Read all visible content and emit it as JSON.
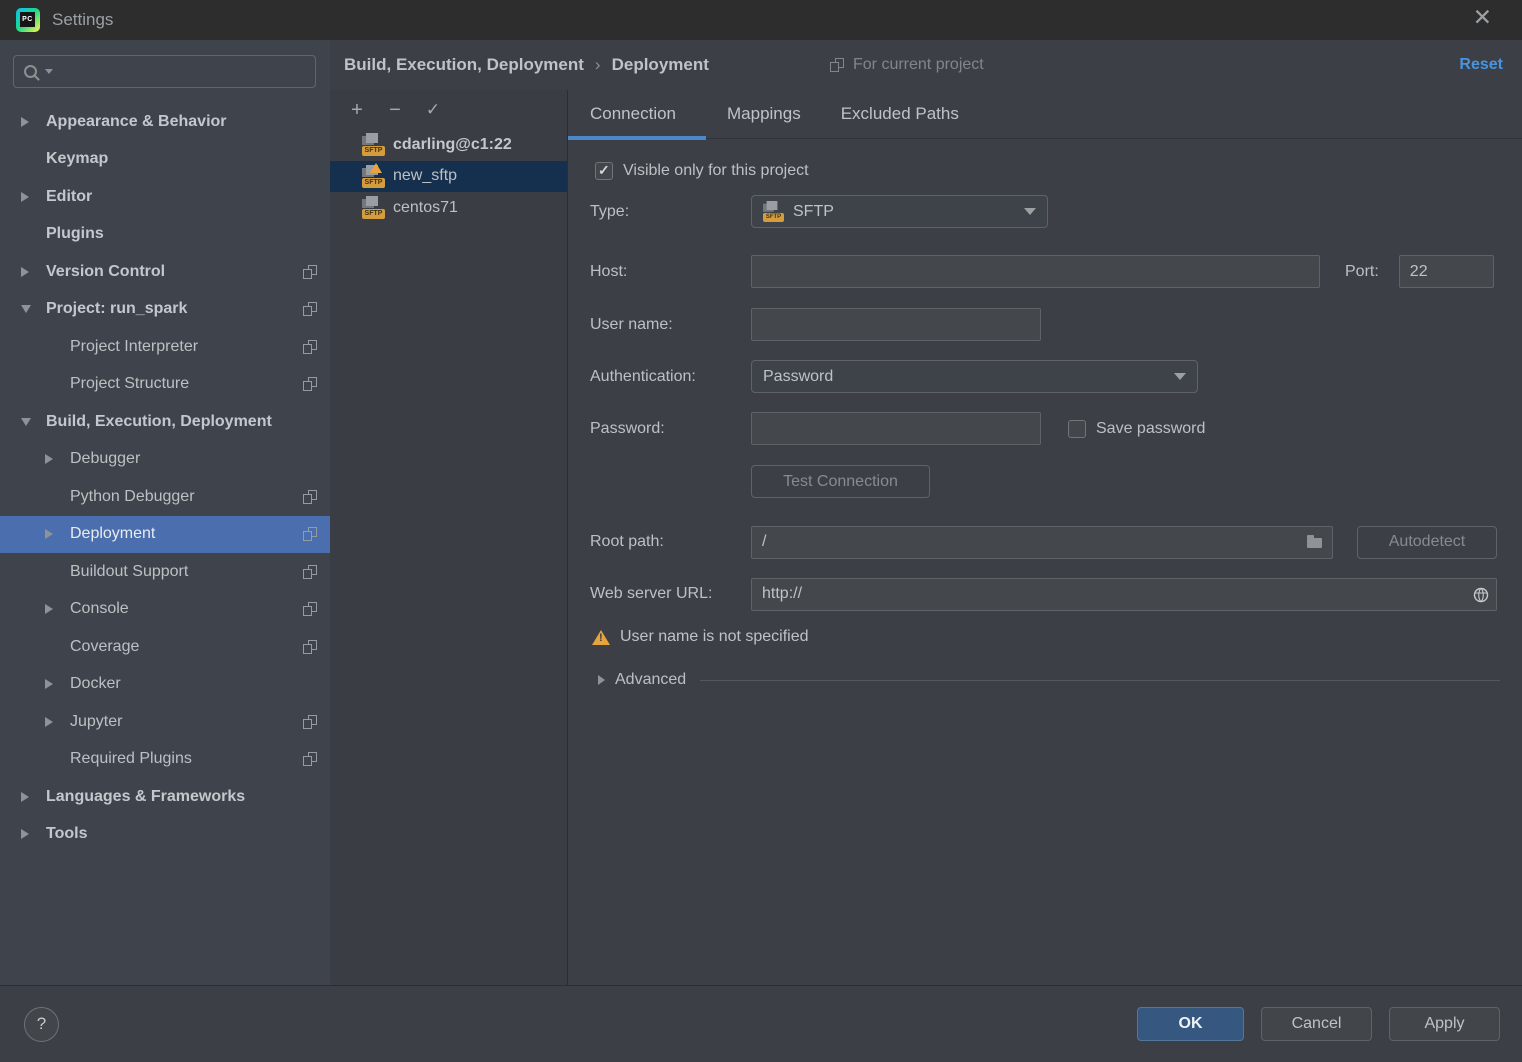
{
  "window": {
    "title": "Settings",
    "close_glyph": "✕",
    "logo_text": "PC"
  },
  "sidebar": {
    "search": {
      "value": "",
      "placeholder": ""
    },
    "items": [
      {
        "label": "Appearance & Behavior"
      },
      {
        "label": "Keymap"
      },
      {
        "label": "Editor"
      },
      {
        "label": "Plugins"
      },
      {
        "label": "Version Control"
      },
      {
        "label": "Project: run_spark"
      },
      {
        "label": "Project Interpreter"
      },
      {
        "label": "Project Structure"
      },
      {
        "label": "Build, Execution, Deployment"
      },
      {
        "label": "Debugger"
      },
      {
        "label": "Python Debugger"
      },
      {
        "label": "Deployment"
      },
      {
        "label": "Buildout Support"
      },
      {
        "label": "Console"
      },
      {
        "label": "Coverage"
      },
      {
        "label": "Docker"
      },
      {
        "label": "Jupyter"
      },
      {
        "label": "Required Plugins"
      },
      {
        "label": "Languages & Frameworks"
      },
      {
        "label": "Tools"
      }
    ]
  },
  "breadcrumb": {
    "part1": "Build, Execution, Deployment",
    "separator": "›",
    "part2": "Deployment"
  },
  "header": {
    "for_current_project": "For current project",
    "reset_label": "Reset"
  },
  "server_panel": {
    "toolbar": {
      "add": "+",
      "remove": "−",
      "apply_check": "✓"
    },
    "servers": [
      {
        "name": "cdarling@c1:22",
        "badge": "SFTP"
      },
      {
        "name": "new_sftp",
        "badge": "SFTP"
      },
      {
        "name": "centos71",
        "badge": "SFTP"
      }
    ]
  },
  "tabs": {
    "connection": "Connection",
    "mappings": "Mappings",
    "excluded": "Excluded Paths"
  },
  "form": {
    "visible_only": {
      "label": "Visible only for this project",
      "checked": true
    },
    "type": {
      "label": "Type:",
      "value": "SFTP",
      "badge": "SFTP"
    },
    "host": {
      "label": "Host:",
      "value": ""
    },
    "port": {
      "label": "Port:",
      "value": "22"
    },
    "user": {
      "label": "User name:",
      "value": ""
    },
    "auth": {
      "label": "Authentication:",
      "value": "Password"
    },
    "password": {
      "label": "Password:",
      "value": "",
      "save_label": "Save password"
    },
    "test_button": "Test Connection",
    "root": {
      "label": "Root path:",
      "value": "/",
      "autodetect": "Autodetect"
    },
    "web": {
      "label": "Web server URL:",
      "value": "http://"
    },
    "warning": "User name is not specified",
    "advanced": "Advanced"
  },
  "footer": {
    "help": "?",
    "ok": "OK",
    "cancel": "Cancel",
    "apply": "Apply"
  },
  "colors": {
    "accent_blue": "#4B6EAF",
    "tab_underline": "#4A88C7",
    "link_blue": "#4794E0",
    "ok_button": "#365880",
    "warning_orange": "#E8A33D",
    "sftp_badge": "#D49C3D",
    "selected_server_row": "#15304F",
    "sidebar_bg": "#3F444C",
    "panel_bg": "#3C4046",
    "titlebar_bg": "#2D2D2D"
  }
}
